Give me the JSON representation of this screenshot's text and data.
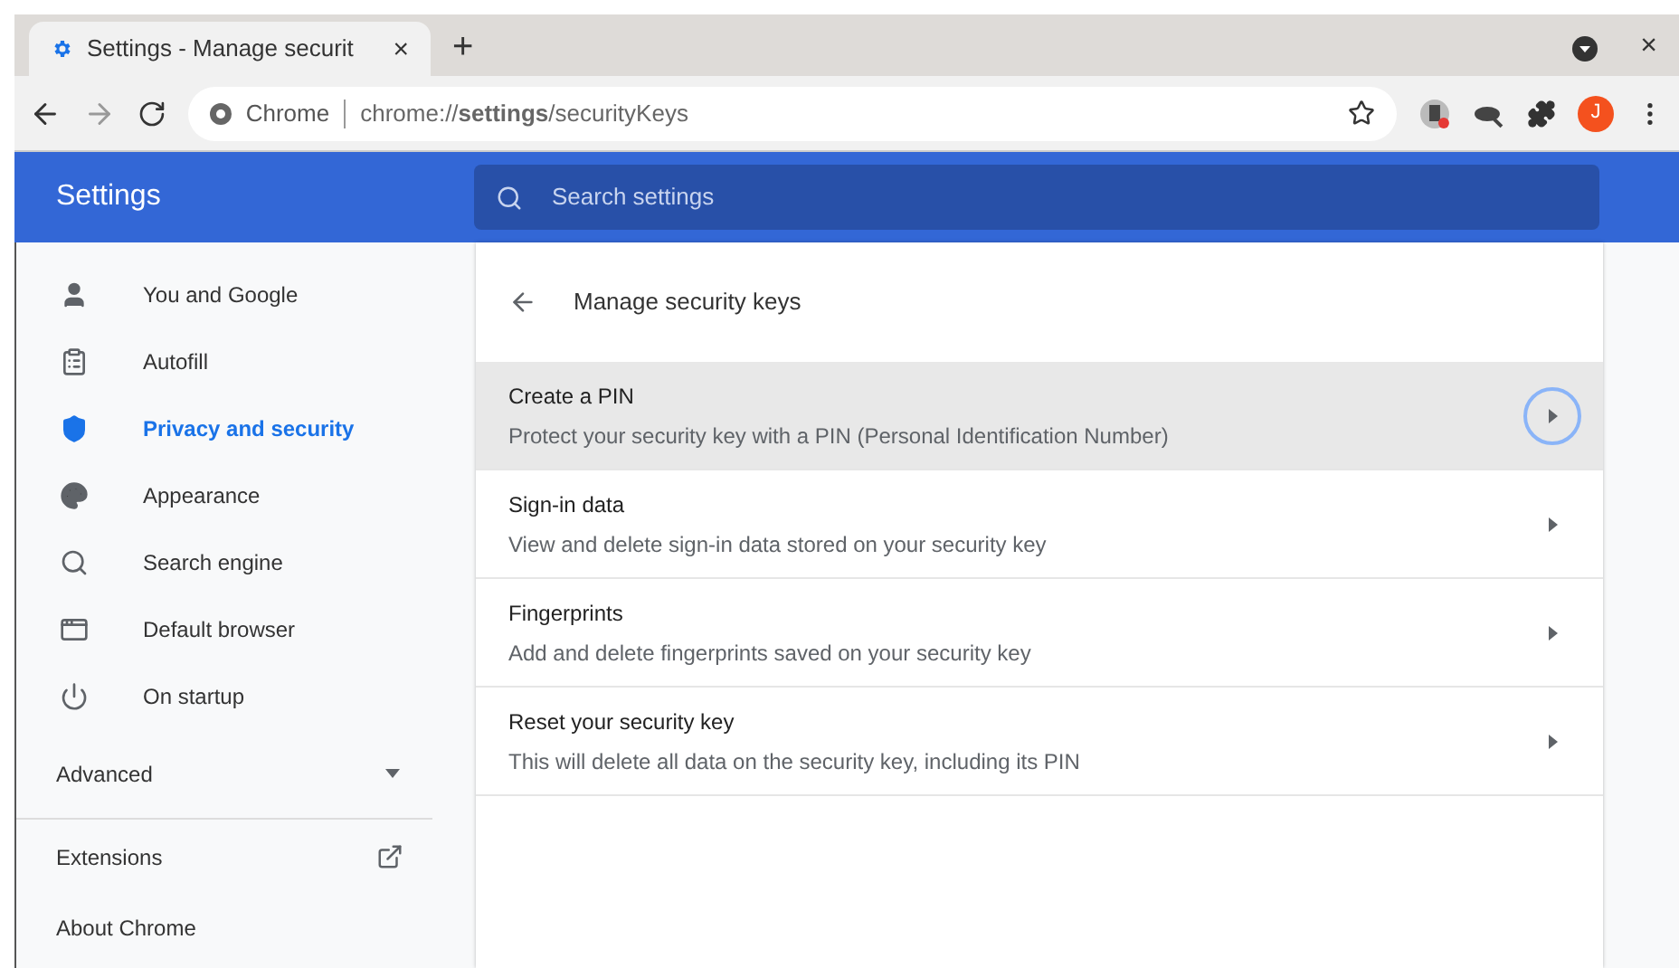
{
  "tab": {
    "title": "Settings - Manage securit",
    "close": "×",
    "new_tab": "+"
  },
  "toolbar": {
    "site_label": "Chrome",
    "url": "chrome://**settings**/securityKeys",
    "avatar": "J",
    "close": "×"
  },
  "header": {
    "title": "Settings",
    "search": {
      "placeholder": "Search settings"
    }
  },
  "sidebar": {
    "items": [
      {
        "label": "You and Google",
        "selected": false
      },
      {
        "label": "Autofill",
        "selected": false
      },
      {
        "label": "Privacy and security",
        "selected": true
      },
      {
        "label": "Appearance",
        "selected": false
      },
      {
        "label": "Search engine",
        "selected": false
      },
      {
        "label": "Default browser",
        "selected": false
      },
      {
        "label": "On startup",
        "selected": false
      }
    ],
    "advanced": {
      "label": "Advanced",
      "expanded": false
    },
    "links": [
      {
        "label": "Extensions",
        "external": true
      },
      {
        "label": "About Chrome",
        "external": false
      }
    ]
  },
  "page": {
    "title": "Manage security keys",
    "rows": [
      {
        "title": "Create a PIN",
        "subtitle": "Protect your security key with a PIN (Personal Identification Number)",
        "selected": true
      },
      {
        "title": "Sign-in data",
        "subtitle": "View and delete sign-in data stored on your security key",
        "selected": false
      },
      {
        "title": "Fingerprints",
        "subtitle": "Add and delete fingerprints saved on your security key",
        "selected": false
      },
      {
        "title": "Reset your security key",
        "subtitle": "This will delete all data on the security key, including its PIN",
        "selected": false
      }
    ]
  }
}
